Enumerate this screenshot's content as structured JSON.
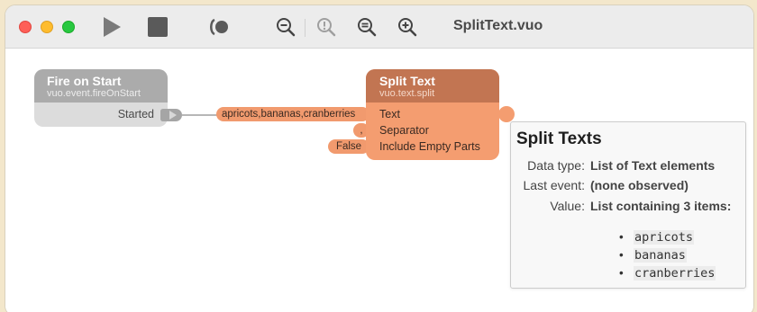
{
  "window": {
    "title": "SplitText.vuo"
  },
  "toolbar": {
    "buttons": [
      "play",
      "stop",
      "step",
      "zoom-out",
      "zoom-to-fit",
      "actual-size",
      "zoom-in"
    ]
  },
  "nodes": {
    "fire_on_start": {
      "title": "Fire on Start",
      "class_name": "vuo.event.fireOnStart",
      "output_port": "Started"
    },
    "split_text": {
      "title": "Split Text",
      "class_name": "vuo.text.split",
      "input_ports": [
        "Text",
        "Separator",
        "Include Empty Parts"
      ],
      "input_values": [
        "apricots,bananas,cranberries",
        ",",
        "False"
      ]
    }
  },
  "popover": {
    "title": "Split Texts",
    "rows": [
      {
        "label": "Data type:",
        "value": "List of Text elements"
      },
      {
        "label": "Last event:",
        "value": "(none observed)"
      },
      {
        "label": "Value:",
        "value": "List containing 3 items:"
      }
    ],
    "items": [
      "apricots",
      "bananas",
      "cranberries"
    ]
  },
  "colors": {
    "traffic_close": "#fe5f57",
    "traffic_minimize": "#febc2e",
    "traffic_zoom": "#28c840",
    "fire_node_header": "#ababab",
    "split_node_header": "#c27552",
    "split_node_body": "#f49d70",
    "port_pill": "#f19a6e"
  }
}
